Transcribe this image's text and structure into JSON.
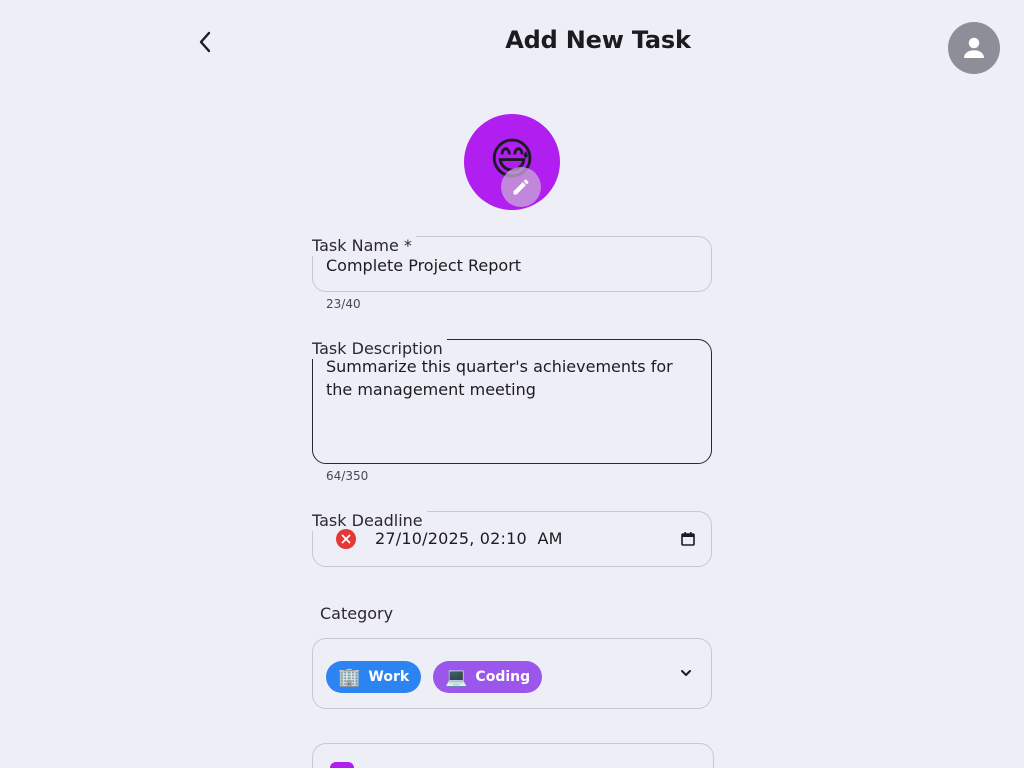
{
  "header": {
    "title": "Add New Task",
    "back_icon": "chevron-left-icon",
    "account_icon": "person-icon"
  },
  "emoji": {
    "value": "😅",
    "background": "#b01ef0",
    "edit_icon": "pencil-icon"
  },
  "task_name": {
    "label": "Task Name *",
    "value": "Complete Project Report",
    "counter": "23/40"
  },
  "task_description": {
    "label": "Task Description",
    "value": "Summarize this quarter's achievements for the management meeting",
    "counter": "64/350"
  },
  "task_deadline": {
    "label": "Task Deadline",
    "value": "27/10/2025, 02:10  AM",
    "clear_icon": "close-icon",
    "calendar_icon": "calendar-icon"
  },
  "category": {
    "label": "Category",
    "chips": [
      {
        "emoji": "🏢",
        "label": "Work",
        "color": "#2b84f2"
      },
      {
        "emoji": "💻",
        "label": "Coding",
        "color": "#9b56ec"
      }
    ],
    "dropdown_icon": "chevron-down-icon"
  },
  "colors": {
    "accent": "#b01ef0",
    "background": "#eeeef6",
    "error": "#e53935"
  }
}
